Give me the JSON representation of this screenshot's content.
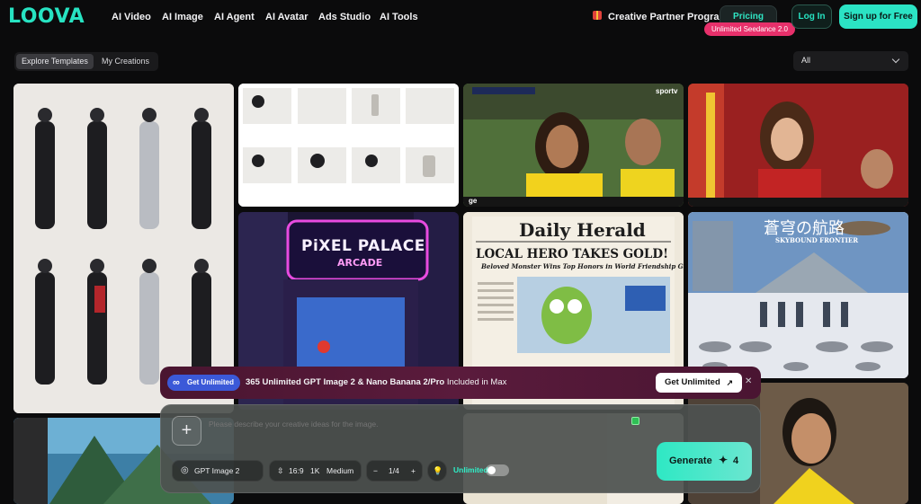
{
  "brand": {
    "logo": "LOOVA",
    "accent": "#27e3c2"
  },
  "nav": {
    "items": [
      "AI Video",
      "AI Image",
      "AI Agent",
      "AI Avatar",
      "Ads Studio",
      "AI Tools"
    ],
    "partner": "Creative Partner Program",
    "pricing": "Pricing",
    "pricing_badge": "Unlimited Seedance 2.0",
    "login": "Log In",
    "signup": "Sign up for Free"
  },
  "filters": {
    "tabs": [
      "Explore Templates",
      "My Creations"
    ],
    "active_tab": "Explore Templates",
    "select_value": "All"
  },
  "gallery": {
    "newspaper": {
      "masthead": "Daily Herald",
      "headline": "LOCAL HERO TAKES GOLD!",
      "subhead": "Beloved Monster Wins Top Honors in World Friendship Games"
    },
    "arcade": {
      "sign_top": "PiXEL PALACE",
      "sign_bottom": "ARCADE"
    },
    "fantasy": {
      "title_cjk": "蒼穹の航路",
      "subtitle": "SKYBOUND FRONTIER"
    },
    "sports": {
      "broadcaster": "sportv",
      "ticker": "ge"
    }
  },
  "promo": {
    "pill": "Get Unlimited",
    "text": "365 Unlimited GPT Image 2 & Nano Banana 2/Pro",
    "suffix": "Included in Max",
    "button": "Get Unlimited"
  },
  "composer": {
    "placeholder": "Please describe your creative ideas for the image.",
    "model": "GPT Image 2",
    "ratio": "16:9",
    "resolution": "1K",
    "quality": "Medium",
    "count": "1/4",
    "unlimited_label": "Unlimited",
    "unlimited_on": false,
    "generate": "Generate",
    "cost": "4"
  }
}
